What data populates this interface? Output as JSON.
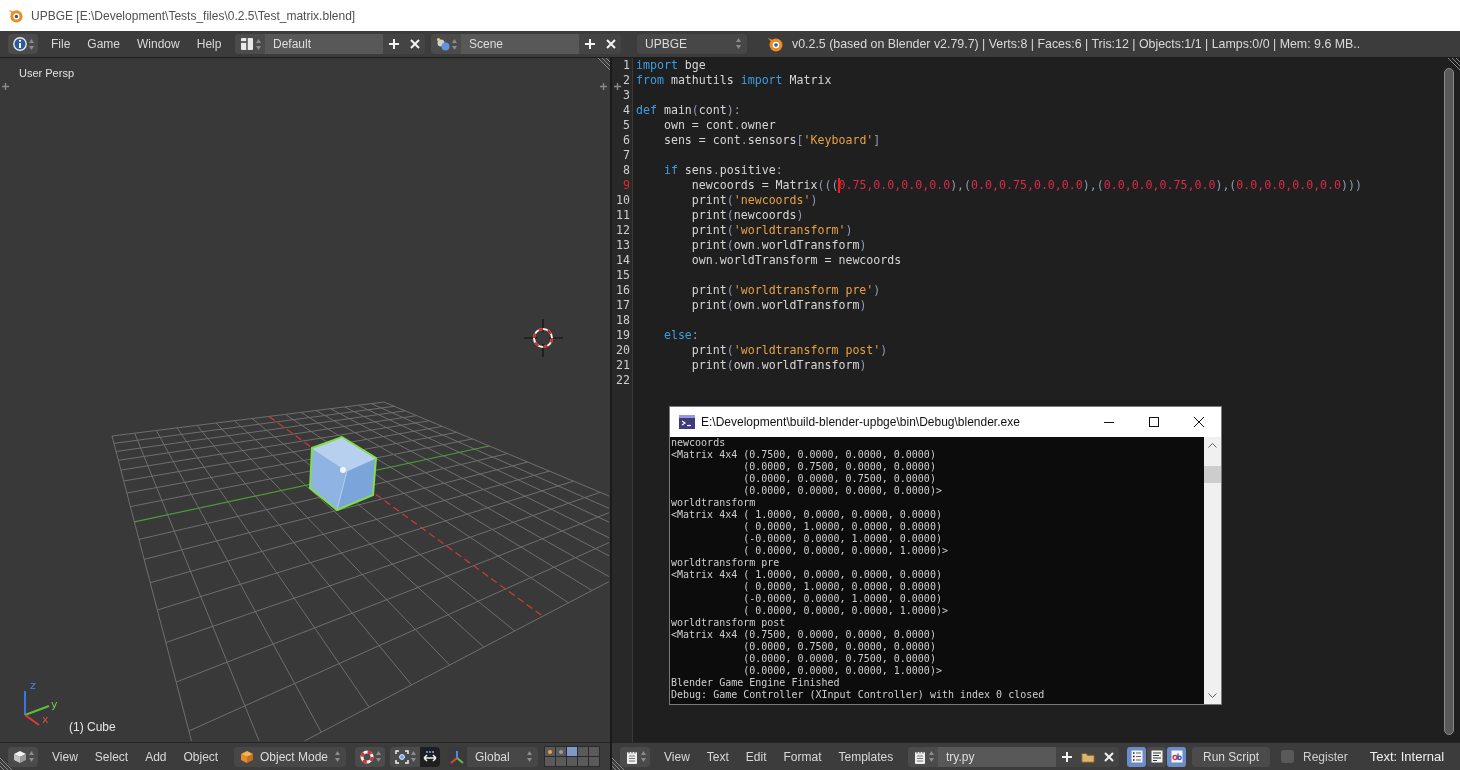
{
  "window": {
    "title": "UPBGE [E:\\Development\\Tests_files\\0.2.5\\Test_matrix.blend]"
  },
  "info_header": {
    "menus": [
      "File",
      "Game",
      "Window",
      "Help"
    ],
    "screen_layout": "Default",
    "scene": "Scene",
    "render_engine": "UPBGE",
    "stats": "v0.2.5 (based on Blender v2.79.7) | Verts:8 | Faces:6 | Tris:12 | Objects:1/1 | Lamps:0/0 | Mem: 9.6 MB.."
  },
  "viewport": {
    "view_name": "User Persp",
    "object_label": "(1) Cube",
    "axis_labels": [
      "z",
      "y",
      "x"
    ]
  },
  "viewport_header": {
    "menus": [
      "View",
      "Select",
      "Add",
      "Object"
    ],
    "mode": "Object Mode",
    "translate_manipulator": {
      "on": true
    },
    "orientation": "Global",
    "layers": [
      {
        "kind": "active_object",
        "selected": false
      },
      {
        "kind": "object",
        "selected": false
      },
      {
        "kind": "empty",
        "selected": true
      },
      {
        "kind": "empty",
        "selected": false
      },
      {
        "kind": "empty",
        "selected": false
      },
      {
        "kind": "empty",
        "selected": false
      },
      {
        "kind": "empty",
        "selected": false
      },
      {
        "kind": "empty",
        "selected": false
      },
      {
        "kind": "empty",
        "selected": false
      },
      {
        "kind": "empty",
        "selected": false
      }
    ]
  },
  "text_editor": {
    "lines": [
      {
        "number": "1",
        "current": false,
        "tokens": [
          {
            "kind": "keyword",
            "text": "import"
          },
          {
            "kind": "plain",
            "text": " bge"
          }
        ]
      },
      {
        "number": "2",
        "current": false,
        "tokens": [
          {
            "kind": "keyword",
            "text": "from"
          },
          {
            "kind": "plain",
            "text": " mathutils "
          },
          {
            "kind": "keyword",
            "text": "import"
          },
          {
            "kind": "plain",
            "text": " Matrix"
          }
        ]
      },
      {
        "number": "3",
        "current": false
      },
      {
        "number": "4",
        "current": false,
        "tokens": [
          {
            "kind": "keyword",
            "text": "def"
          },
          {
            "kind": "plain",
            "text": " main"
          },
          {
            "kind": "symbol",
            "text": "("
          },
          {
            "kind": "plain",
            "text": "cont"
          },
          {
            "kind": "symbol",
            "text": "):"
          }
        ]
      },
      {
        "number": "5",
        "current": false,
        "tokens": [
          {
            "kind": "plain",
            "text": "    own = cont"
          },
          {
            "kind": "symbol",
            "text": "."
          },
          {
            "kind": "plain",
            "text": "owner"
          }
        ]
      },
      {
        "number": "6",
        "current": false,
        "tokens": [
          {
            "kind": "plain",
            "text": "    sens = cont"
          },
          {
            "kind": "symbol",
            "text": "."
          },
          {
            "kind": "plain",
            "text": "sensors"
          },
          {
            "kind": "symbol",
            "text": "["
          },
          {
            "kind": "string",
            "text": "'Keyboard'"
          },
          {
            "kind": "symbol",
            "text": "]"
          }
        ]
      },
      {
        "number": "7",
        "current": false
      },
      {
        "number": "8",
        "current": false,
        "tokens": [
          {
            "kind": "keyword",
            "text": "    if"
          },
          {
            "kind": "plain",
            "text": " sens"
          },
          {
            "kind": "symbol",
            "text": "."
          },
          {
            "kind": "plain",
            "text": "positive"
          },
          {
            "kind": "symbol",
            "text": ":"
          }
        ]
      },
      {
        "number": "9",
        "current": true,
        "tokens": [
          {
            "kind": "plain",
            "text": "        newcoords = Matrix"
          },
          {
            "kind": "symbol",
            "text": "((("
          },
          {
            "kind": "number",
            "text": "0.75,0.0,0.0,0.0",
            "cursor": true
          },
          {
            "kind": "symbol",
            "text": "),("
          },
          {
            "kind": "number",
            "text": "0.0,0.75,0.0,0.0"
          },
          {
            "kind": "symbol",
            "text": "),("
          },
          {
            "kind": "number",
            "text": "0.0,0.0,0.75,0.0"
          },
          {
            "kind": "symbol",
            "text": "),("
          },
          {
            "kind": "number",
            "text": "0.0,0.0,0.0,0.0"
          },
          {
            "kind": "symbol",
            "text": ")))"
          }
        ]
      },
      {
        "number": "10",
        "current": false,
        "tokens": [
          {
            "kind": "plain",
            "text": "        print"
          },
          {
            "kind": "symbol",
            "text": "("
          },
          {
            "kind": "string",
            "text": "'newcoords'"
          },
          {
            "kind": "symbol",
            "text": ")"
          }
        ]
      },
      {
        "number": "11",
        "current": false,
        "tokens": [
          {
            "kind": "plain",
            "text": "        print"
          },
          {
            "kind": "symbol",
            "text": "("
          },
          {
            "kind": "plain",
            "text": "newcoords"
          },
          {
            "kind": "symbol",
            "text": ")"
          }
        ]
      },
      {
        "number": "12",
        "current": false,
        "tokens": [
          {
            "kind": "plain",
            "text": "        print"
          },
          {
            "kind": "symbol",
            "text": "("
          },
          {
            "kind": "string",
            "text": "'worldtransform'"
          },
          {
            "kind": "symbol",
            "text": ")"
          }
        ]
      },
      {
        "number": "13",
        "current": false,
        "tokens": [
          {
            "kind": "plain",
            "text": "        print"
          },
          {
            "kind": "symbol",
            "text": "("
          },
          {
            "kind": "plain",
            "text": "own"
          },
          {
            "kind": "symbol",
            "text": "."
          },
          {
            "kind": "plain",
            "text": "worldTransform"
          },
          {
            "kind": "symbol",
            "text": ")"
          }
        ]
      },
      {
        "number": "14",
        "current": false,
        "tokens": [
          {
            "kind": "plain",
            "text": "        own"
          },
          {
            "kind": "symbol",
            "text": "."
          },
          {
            "kind": "plain",
            "text": "worldTransform = newcoords"
          }
        ]
      },
      {
        "number": "15",
        "current": false
      },
      {
        "number": "16",
        "current": false,
        "tokens": [
          {
            "kind": "plain",
            "text": "        print"
          },
          {
            "kind": "symbol",
            "text": "("
          },
          {
            "kind": "string",
            "text": "'worldtransform pre'"
          },
          {
            "kind": "symbol",
            "text": ")"
          }
        ]
      },
      {
        "number": "17",
        "current": false,
        "tokens": [
          {
            "kind": "plain",
            "text": "        print"
          },
          {
            "kind": "symbol",
            "text": "("
          },
          {
            "kind": "plain",
            "text": "own"
          },
          {
            "kind": "symbol",
            "text": "."
          },
          {
            "kind": "plain",
            "text": "worldTransform"
          },
          {
            "kind": "symbol",
            "text": ")"
          }
        ]
      },
      {
        "number": "18",
        "current": false
      },
      {
        "number": "19",
        "current": false,
        "tokens": [
          {
            "kind": "keyword",
            "text": "    else"
          },
          {
            "kind": "symbol",
            "text": ":"
          }
        ]
      },
      {
        "number": "20",
        "current": false,
        "tokens": [
          {
            "kind": "plain",
            "text": "        print"
          },
          {
            "kind": "symbol",
            "text": "("
          },
          {
            "kind": "string",
            "text": "'worldtransform post'"
          },
          {
            "kind": "symbol",
            "text": ")"
          }
        ]
      },
      {
        "number": "21",
        "current": false,
        "tokens": [
          {
            "kind": "plain",
            "text": "        print"
          },
          {
            "kind": "symbol",
            "text": "("
          },
          {
            "kind": "plain",
            "text": "own"
          },
          {
            "kind": "symbol",
            "text": "."
          },
          {
            "kind": "plain",
            "text": "worldTransform"
          },
          {
            "kind": "symbol",
            "text": ")"
          }
        ]
      },
      {
        "number": "22",
        "current": false
      }
    ]
  },
  "text_header": {
    "menus": [
      "View",
      "Text",
      "Edit",
      "Format",
      "Templates"
    ],
    "text_name": "try.py",
    "toggles": [
      {
        "kind": "line_numbers",
        "on": true
      },
      {
        "kind": "word_wrap",
        "on": false
      },
      {
        "kind": "syntax_highlight",
        "on": true
      }
    ],
    "run_button": "Run Script",
    "register": {
      "label": "Register",
      "checked": false
    },
    "text_source": "Text: Internal"
  },
  "console": {
    "title": "E:\\Development\\build-blender-upbge\\bin\\Debug\\blender.exe",
    "lines": [
      "newcoords",
      "<Matrix 4x4 (0.7500, 0.0000, 0.0000, 0.0000)",
      "            (0.0000, 0.7500, 0.0000, 0.0000)",
      "            (0.0000, 0.0000, 0.7500, 0.0000)",
      "            (0.0000, 0.0000, 0.0000, 0.0000)>",
      "worldtransform",
      "<Matrix 4x4 ( 1.0000, 0.0000, 0.0000, 0.0000)",
      "            ( 0.0000, 1.0000, 0.0000, 0.0000)",
      "            (-0.0000, 0.0000, 1.0000, 0.0000)",
      "            ( 0.0000, 0.0000, 0.0000, 1.0000)>",
      "worldtransform pre",
      "<Matrix 4x4 ( 1.0000, 0.0000, 0.0000, 0.0000)",
      "            ( 0.0000, 1.0000, 0.0000, 0.0000)",
      "            (-0.0000, 0.0000, 1.0000, 0.0000)",
      "            ( 0.0000, 0.0000, 0.0000, 1.0000)>",
      "worldtransform post",
      "<Matrix 4x4 (0.7500, 0.0000, 0.0000, 0.0000)",
      "            (0.0000, 0.7500, 0.0000, 0.0000)",
      "            (0.0000, 0.0000, 0.7500, 0.0000)",
      "            (0.0000, 0.0000, 0.0000, 1.0000)>",
      "Blender Game Engine Finished",
      "Debug: Game Controller (XInput Controller) with index 0 closed"
    ]
  }
}
